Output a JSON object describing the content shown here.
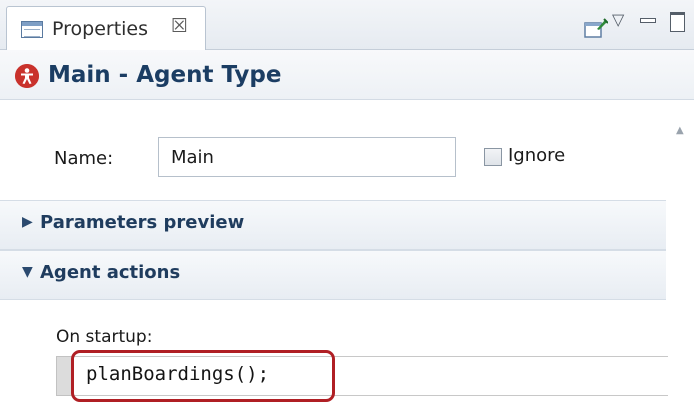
{
  "tab": {
    "title": "Properties",
    "close_glyph": "☒",
    "icon": "properties-view-icon"
  },
  "toolbar": {
    "pin_icon": "pin-editor-icon",
    "menu_glyph": "▽",
    "minimize_icon": "minimize-icon",
    "maximize_icon": "maximize-icon"
  },
  "header": {
    "icon": "agent-type-icon",
    "title": "Main - Agent Type"
  },
  "form": {
    "name_label": "Name:",
    "name_value": "Main",
    "ignore_label": "Ignore",
    "ignore_checked": false
  },
  "sections": [
    {
      "title": "Parameters preview",
      "expanded": false,
      "toggle_glyph": "▶"
    },
    {
      "title": "Agent actions",
      "expanded": true,
      "toggle_glyph": "▼"
    }
  ],
  "agent_actions": {
    "on_startup_label": "On startup:",
    "on_startup_code": "planBoardings();"
  },
  "colors": {
    "title_text": "#1b3d63",
    "agent_icon": "#c9322c",
    "highlight": "#b01f24"
  }
}
